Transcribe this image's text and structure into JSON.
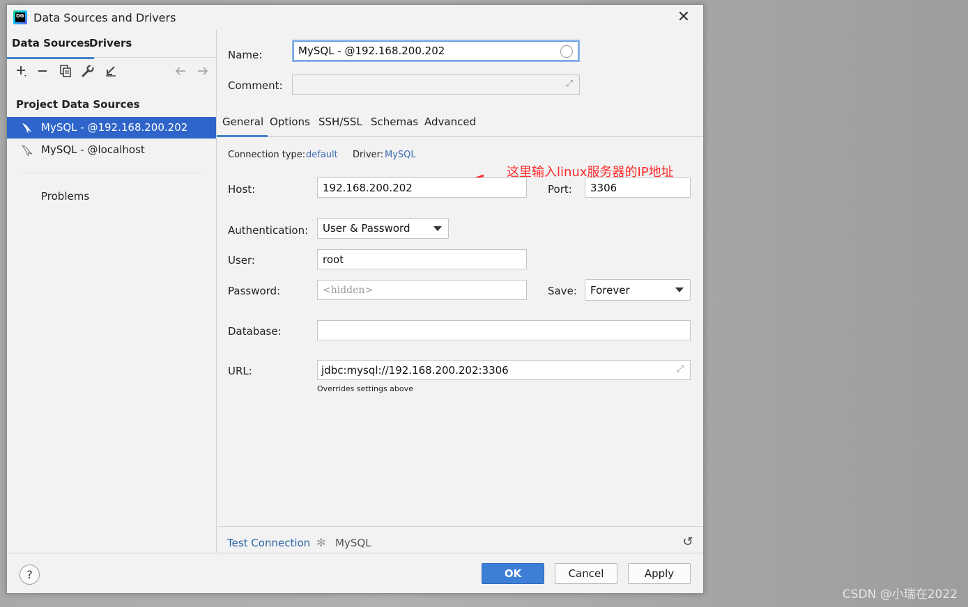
{
  "window": {
    "title": "Data Sources and Drivers",
    "app_icon": "datagrip-icon",
    "app_icon_text": "DG"
  },
  "sidebar": {
    "tabs": [
      {
        "label": "Data Sources",
        "active": true
      },
      {
        "label": "Drivers",
        "active": false
      }
    ],
    "toolbar_icons": [
      "plus-icon",
      "minus-icon",
      "duplicate-icon",
      "wrench-icon",
      "import-icon",
      "back-arrow-icon",
      "forward-arrow-icon"
    ],
    "section_title": "Project Data Sources",
    "items": [
      {
        "label": "MySQL - @192.168.200.202",
        "selected": true,
        "icon": "mysql-dolphin-icon"
      },
      {
        "label": "MySQL - @localhost",
        "selected": false,
        "icon": "mysql-dolphin-icon"
      }
    ],
    "problems_label": "Problems"
  },
  "form": {
    "name_label": "Name:",
    "name_value": "MySQL - @192.168.200.202",
    "comment_label": "Comment:",
    "comment_value": "",
    "tabs": [
      {
        "label": "General",
        "active": true
      },
      {
        "label": "Options",
        "active": false
      },
      {
        "label": "SSH/SSL",
        "active": false
      },
      {
        "label": "Schemas",
        "active": false
      },
      {
        "label": "Advanced",
        "active": false
      }
    ],
    "connection_type_label": "Connection type:",
    "connection_type_value": "default",
    "driver_label": "Driver:",
    "driver_value": "MySQL",
    "host_label": "Host:",
    "host_value": "192.168.200.202",
    "port_label": "Port:",
    "port_value": "3306",
    "auth_label": "Authentication:",
    "auth_value": "User & Password",
    "user_label": "User:",
    "user_value": "root",
    "password_label": "Password:",
    "password_placeholder": "<hidden>",
    "save_label": "Save:",
    "save_value": "Forever",
    "database_label": "Database:",
    "database_value": "",
    "url_label": "URL:",
    "url_value": "jdbc:mysql://192.168.200.202:3306",
    "url_note": "Overrides settings above",
    "annotation": "这里输入linux服务器的IP地址",
    "annotation_color": "#ff2a2a"
  },
  "bottom_bar": {
    "test_connection": "Test Connection",
    "driver_name": "MySQL"
  },
  "footer": {
    "help": "?",
    "ok": "OK",
    "cancel": "Cancel",
    "apply": "Apply"
  },
  "watermark": "CSDN @小瑞在2022",
  "colors": {
    "accent": "#4083c9",
    "selection": "#2f65ca",
    "link": "#2c63a8",
    "primary_button": "#3d7fd6"
  }
}
